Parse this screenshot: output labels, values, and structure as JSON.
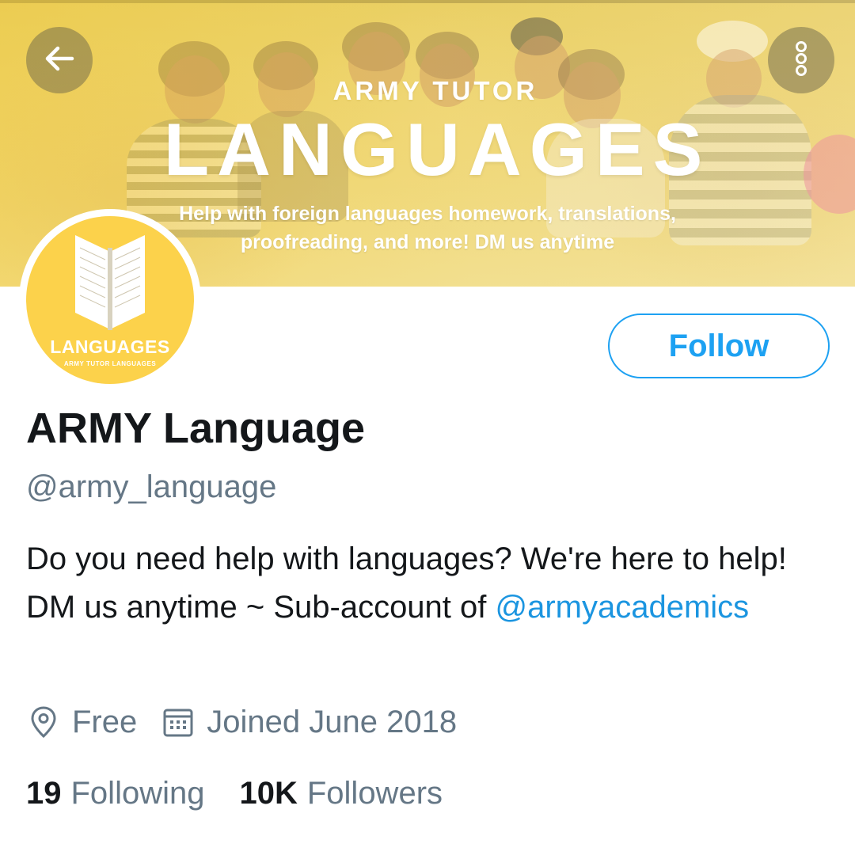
{
  "banner": {
    "kicker": "ARMY TUTOR",
    "title": "LANGUAGES",
    "subtitle_line1": "Help with foreign languages homework, translations,",
    "subtitle_line2": "proofreading, and more! DM us anytime"
  },
  "avatar": {
    "label": "LANGUAGES",
    "sublabel": "ARMY TUTOR LANGUAGES"
  },
  "actions": {
    "back_icon": "arrow-left-icon",
    "more_icon": "more-vertical-icon",
    "follow_label": "Follow"
  },
  "profile": {
    "display_name": "ARMY Language",
    "handle": "@army_language",
    "bio_text": "Do you need help with languages? We're here to help! DM us anytime ~ Sub-account of ",
    "bio_mention": "@armyacademics",
    "location": "Free",
    "joined": "Joined June 2018"
  },
  "stats": {
    "following_count": "19",
    "following_label": "Following",
    "followers_count": "10K",
    "followers_label": "Followers"
  },
  "colors": {
    "accent": "#1da1f2",
    "mention": "#1b95e0",
    "secondary_text": "#657786",
    "avatar_bg": "#fcd24b"
  }
}
